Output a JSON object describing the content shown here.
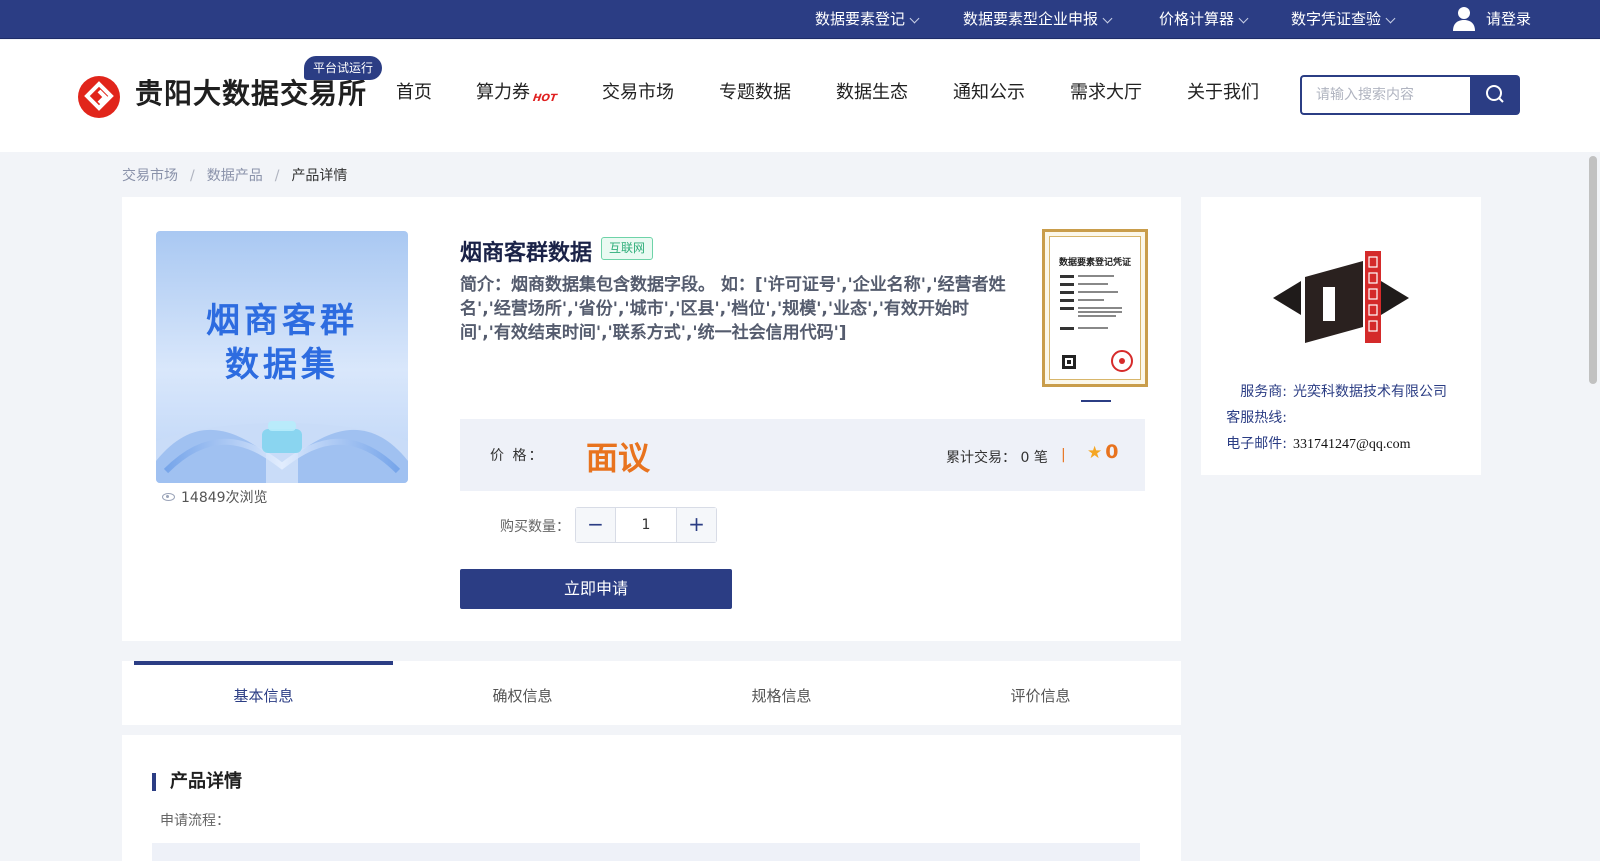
{
  "topbar": {
    "items": [
      {
        "label": "数据要素登记"
      },
      {
        "label": "数据要素型企业申报"
      },
      {
        "label": "价格计算器"
      },
      {
        "label": "数字凭证查验"
      }
    ],
    "login_label": "请登录"
  },
  "header": {
    "logo_text": "贵阳大数据交易所",
    "trial_badge": "平台试运行",
    "nav": [
      "首页",
      "算力券",
      "交易市场",
      "专题数据",
      "数据生态",
      "通知公示",
      "需求大厅",
      "关于我们"
    ],
    "hot_tag": "HOT",
    "search_placeholder": "请输入搜索内容"
  },
  "breadcrumb": [
    "交易市场",
    "数据产品",
    "产品详情"
  ],
  "product": {
    "image_text_line1": "烟商客群",
    "image_text_line2": "数据集",
    "views": "14849次浏览",
    "title": "烟商客群数据",
    "tag": "互联网",
    "description": "简介：烟商数据集包含数据字段。 如：['许可证号','企业名称','经营者姓名','经营场所','省份','城市','区县','档位','规模','业态','有效开始时间','有效结束时间','联系方式','统一社会信用代码']",
    "cert_title": "数据要素登记凭证",
    "price_label": "价    格：",
    "price_value": "面议",
    "trades_label": "累计交易：",
    "trades_value": "0",
    "trades_unit": "笔",
    "rating": "0",
    "qty_label": "购买数量：",
    "qty_value": "1",
    "apply_button": "立即申请"
  },
  "provider": {
    "service_label": "服务商:",
    "service_value": "光奕科数据技术有限公司",
    "hotline_label": "客服热线:",
    "hotline_value": "",
    "email_label": "电子邮件:",
    "email_value": "331741247@qq.com"
  },
  "tabs": [
    "基本信息",
    "确权信息",
    "规格信息",
    "评价信息"
  ],
  "detail": {
    "title": "产品详情",
    "apply_process_label": "申请流程："
  },
  "colors": {
    "primary": "#2b3d84",
    "price": "#e8731e",
    "tag_green": "#2fae7a",
    "background": "#f2f4f8"
  }
}
